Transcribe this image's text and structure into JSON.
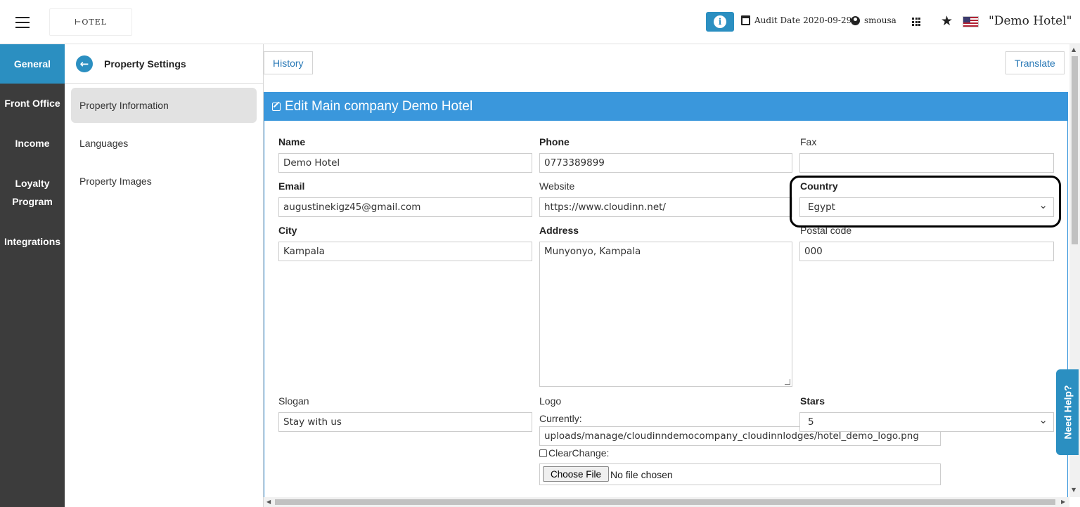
{
  "topbar": {
    "logo_text": "⊢OTEL",
    "audit_date_label": "Audit Date 2020-09-29",
    "username": "smousa",
    "hotel_name": "\"Demo Hotel\""
  },
  "sidebar": {
    "items": [
      {
        "label": "General"
      },
      {
        "label": "Front Office"
      },
      {
        "label": "Income"
      },
      {
        "label": "Loyalty Program"
      },
      {
        "label": "Integrations"
      }
    ]
  },
  "submenu": {
    "title": "Property Settings",
    "items": [
      {
        "label": "Property Information"
      },
      {
        "label": "Languages"
      },
      {
        "label": "Property Images"
      }
    ]
  },
  "main": {
    "history_label": "History",
    "translate_label": "Translate",
    "panel_title": "Edit Main company Demo Hotel",
    "form": {
      "name_label": "Name",
      "name_value": "Demo Hotel",
      "phone_label": "Phone",
      "phone_value": "0773389899",
      "fax_label": "Fax",
      "fax_value": "",
      "email_label": "Email",
      "email_value": "augustinekigz45@gmail.com",
      "website_label": "Website",
      "website_value": "https://www.cloudinn.net/",
      "country_label": "Country",
      "country_value": "Egypt",
      "city_label": "City",
      "city_value": "Kampala",
      "address_label": "Address",
      "address_value": "Munyonyo, Kampala",
      "postal_label": "Postal code",
      "postal_value": "000",
      "slogan_label": "Slogan",
      "slogan_value": "Stay with us",
      "logo_label": "Logo",
      "currently_label": "Currently:",
      "logo_path": "uploads/manage/cloudinndemocompany_cloudinnlodges/hotel_demo_logo.png",
      "clear_change_label": "ClearChange:",
      "choose_file_label": "Choose File",
      "no_file_label": "No file chosen",
      "stars_label": "Stars",
      "stars_value": "5"
    }
  },
  "need_help_label": "Need Help?",
  "colors": {
    "accent": "#2b8fc1",
    "panel_header": "#3a97dc",
    "sidebar_bg": "#3c3c3c"
  }
}
